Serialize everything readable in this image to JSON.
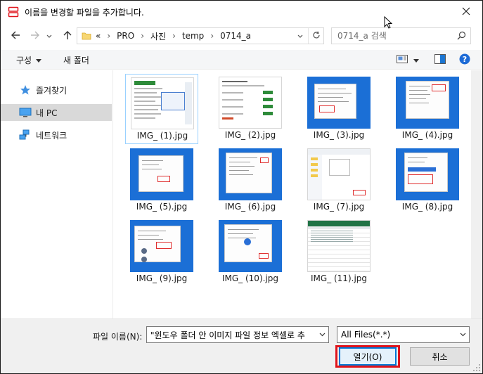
{
  "window": {
    "title": "이름을 변경할 파일을 추가합니다.",
    "accent": "#0078d7",
    "highlight_color": "#e0141c"
  },
  "address": {
    "overflow": "«",
    "crumbs": [
      "PRO",
      "사진",
      "temp",
      "0714_a"
    ],
    "search_placeholder": "0714_a 검색"
  },
  "toolbar": {
    "organize": "구성",
    "new_folder": "새 폴더"
  },
  "sidebar": {
    "items": [
      {
        "label": "즐겨찾기",
        "icon": "star-icon"
      },
      {
        "label": "내 PC",
        "icon": "pc-icon"
      },
      {
        "label": "네트워크",
        "icon": "network-icon"
      }
    ]
  },
  "files": [
    {
      "name": "IMG_ (1).jpg",
      "kind": "doc-green"
    },
    {
      "name": "IMG_ (2).jpg",
      "kind": "doc-list"
    },
    {
      "name": "IMG_ (3).jpg",
      "kind": "desktop"
    },
    {
      "name": "IMG_ (4).jpg",
      "kind": "desktop"
    },
    {
      "name": "IMG_ (5).jpg",
      "kind": "desktop"
    },
    {
      "name": "IMG_ (6).jpg",
      "kind": "desktop"
    },
    {
      "name": "IMG_ (7).jpg",
      "kind": "explorer"
    },
    {
      "name": "IMG_ (8).jpg",
      "kind": "desktop"
    },
    {
      "name": "IMG_ (9).jpg",
      "kind": "desktop"
    },
    {
      "name": "IMG_ (10).jpg",
      "kind": "desktop"
    },
    {
      "name": "IMG_ (11).jpg",
      "kind": "spreadsheet"
    }
  ],
  "bottom": {
    "filename_label": "파일 이름(N):",
    "filename_value": "\"윈도우 폴더 안 이미지 파일 정보 엑셀로 추",
    "filetype": "All Files(*.*)",
    "open_button": "열기(O)",
    "cancel_button": "취소"
  }
}
